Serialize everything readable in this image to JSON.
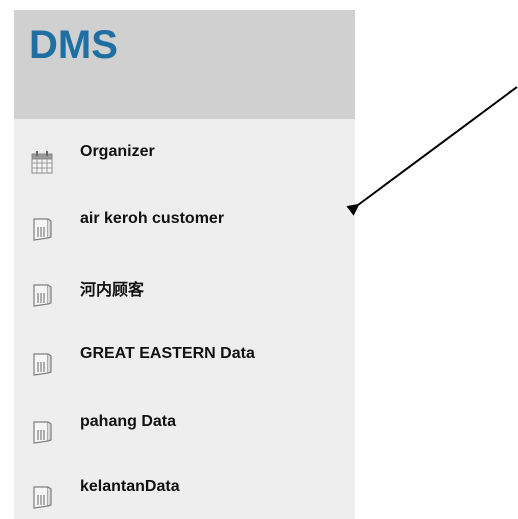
{
  "header": {
    "logo_text": "DMS",
    "logo_color": "#1f6fa3"
  },
  "sidebar": {
    "items": [
      {
        "label": "Organizer",
        "icon": "calendar-icon"
      },
      {
        "label": "air keroh customer",
        "icon": "folder-icon"
      },
      {
        "label": "河内顾客",
        "icon": "folder-icon"
      },
      {
        "label": "GREAT EASTERN Data",
        "icon": "folder-icon"
      },
      {
        "label": "pahang Data",
        "icon": "folder-icon"
      },
      {
        "label": "kelantanData",
        "icon": "folder-icon"
      }
    ]
  },
  "annotation": {
    "arrow_color": "#000000",
    "points_to": "air keroh customer"
  }
}
